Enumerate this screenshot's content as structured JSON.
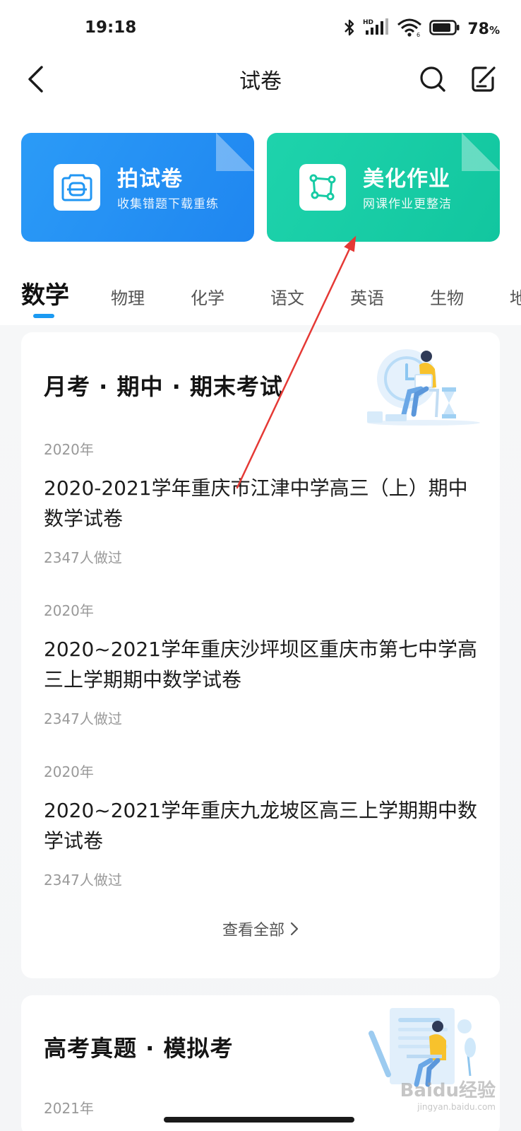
{
  "status_bar": {
    "time": "19:18",
    "battery_percent": "78",
    "battery_unit": "%",
    "icons": [
      "bluetooth-icon",
      "hd-signal-icon",
      "wifi-icon",
      "battery-icon"
    ]
  },
  "nav": {
    "title": "试卷",
    "icons": [
      "back-arrow-icon",
      "search-icon",
      "edit-icon"
    ]
  },
  "actions": [
    {
      "title": "拍试卷",
      "subtitle": "收集错题下载重练",
      "color": "#2196F3",
      "icon": "scan-icon"
    },
    {
      "title": "美化作业",
      "subtitle": "网课作业更整洁",
      "color": "#16CBA4",
      "icon": "crop-icon"
    }
  ],
  "tabs": {
    "items": [
      "数学",
      "物理",
      "化学",
      "语文",
      "英语",
      "生物",
      "地"
    ],
    "active_index": 0,
    "accent": "#1B9AF2"
  },
  "sections": [
    {
      "title": "月考 · 期中 · 期末考试",
      "exams": [
        {
          "year": "2020年",
          "title": "2020-2021学年重庆市江津中学高三（上）期中数学试卷",
          "count": "2347人做过"
        },
        {
          "year": "2020年",
          "title": "2020~2021学年重庆沙坪坝区重庆市第七中学高三上学期期中数学试卷",
          "count": "2347人做过"
        },
        {
          "year": "2020年",
          "title": "2020~2021学年重庆九龙坡区高三上学期期中数学试卷",
          "count": "2347人做过"
        }
      ],
      "view_all": "查看全部"
    },
    {
      "title": "高考真题 · 模拟考",
      "peek_year": "2021年"
    }
  ],
  "watermark": {
    "text": "Baidu经验",
    "sub": "jingyan.baidu.com"
  },
  "annotation_color": "#E53935"
}
